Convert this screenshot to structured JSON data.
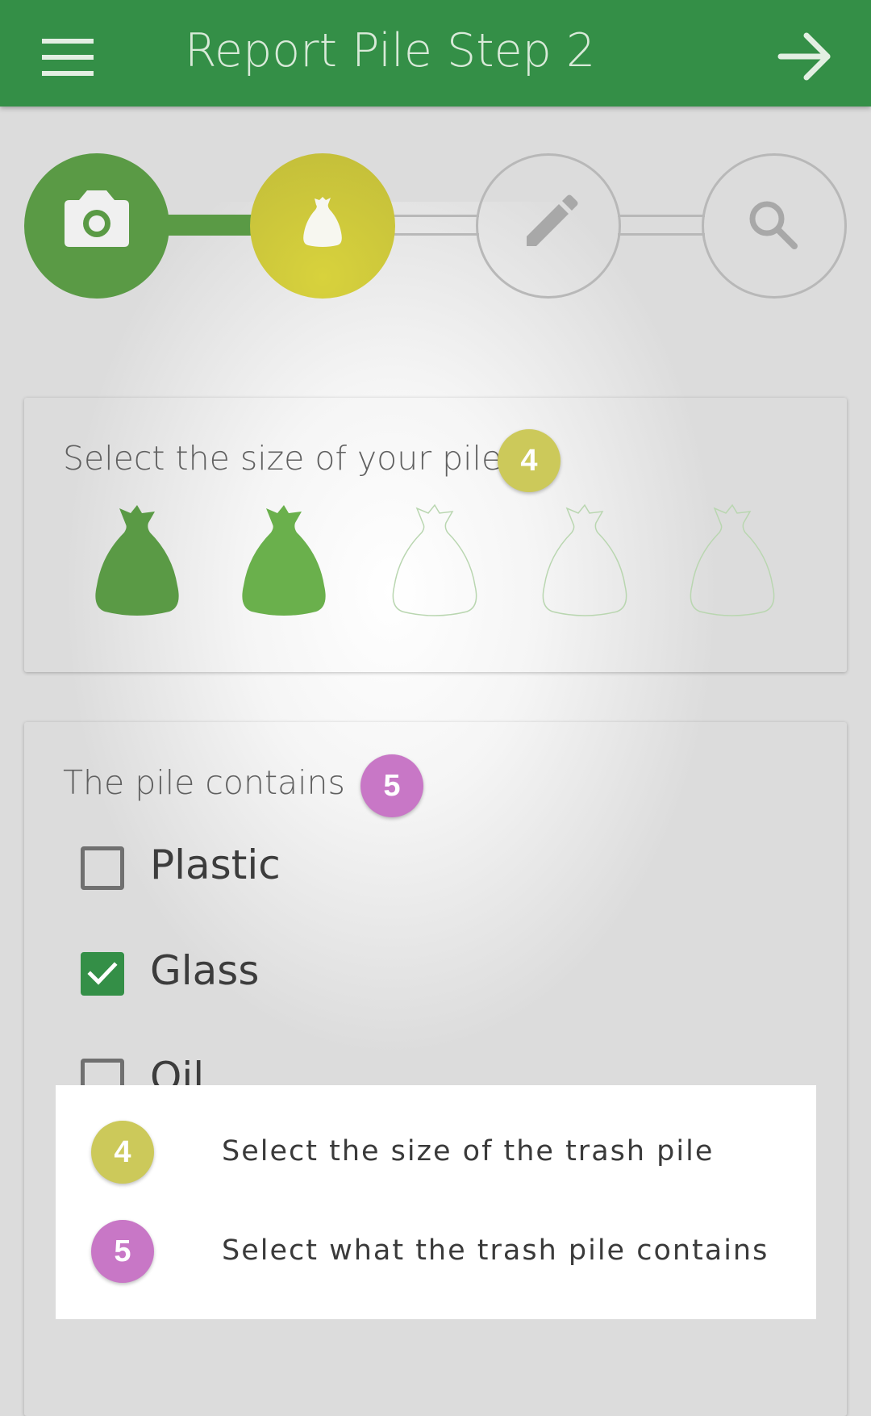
{
  "header": {
    "title": "Report Pile Step 2",
    "menu_icon": "hamburger-menu-icon",
    "next_icon": "arrow-right-icon"
  },
  "stepper": {
    "steps": [
      {
        "icon": "camera-icon",
        "state": "completed",
        "color": "#5a9a45"
      },
      {
        "icon": "trash-bag-icon",
        "state": "current",
        "color": "#c9c33a"
      },
      {
        "icon": "pencil-icon",
        "state": "upcoming"
      },
      {
        "icon": "search-icon",
        "state": "upcoming"
      }
    ]
  },
  "size_card": {
    "title": "Select the size of your pile",
    "badge": "4",
    "badge_color": "#ccc95a",
    "selected_size": 2,
    "max_size": 5
  },
  "contents_card": {
    "title": "The pile contains",
    "badge": "5",
    "badge_color": "#c877c6",
    "options": [
      {
        "label": "Plastic",
        "checked": false
      },
      {
        "label": "Glass",
        "checked": true
      },
      {
        "label": "Oil",
        "checked": false
      }
    ]
  },
  "legend": {
    "items": [
      {
        "badge": "4",
        "text": "Select the size of the trash pile"
      },
      {
        "badge": "5",
        "text": "Select what the trash pile contains"
      }
    ]
  },
  "colors": {
    "primary": "#348f47",
    "light_green": "#6ab04c",
    "yellow": "#ccc95a",
    "purple": "#c877c6"
  }
}
